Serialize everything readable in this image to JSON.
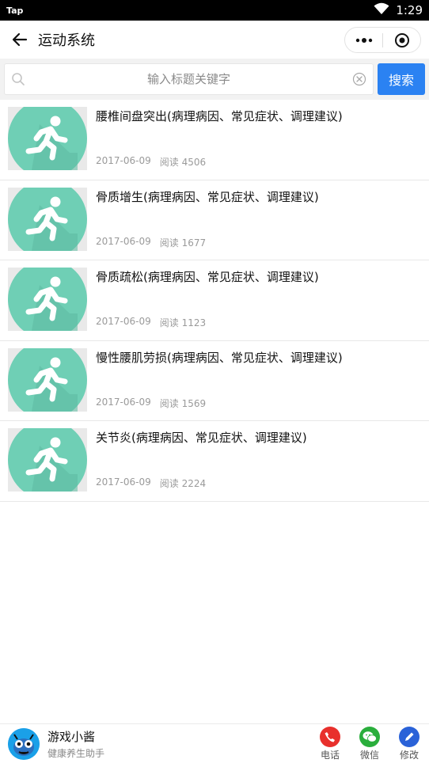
{
  "status_bar": {
    "carrier": "Tap",
    "time": "1:29"
  },
  "nav": {
    "title": "运动系统"
  },
  "search": {
    "placeholder": "输入标题关键字",
    "button_label": "搜索"
  },
  "articles": [
    {
      "title": "腰椎间盘突出(病理病因、常见症状、调理建议)",
      "date": "2017-06-09",
      "reads": "阅读 4506"
    },
    {
      "title": "骨质增生(病理病因、常见症状、调理建议)",
      "date": "2017-06-09",
      "reads": "阅读 1677"
    },
    {
      "title": "骨质疏松(病理病因、常见症状、调理建议)",
      "date": "2017-06-09",
      "reads": "阅读 1123"
    },
    {
      "title": "慢性腰肌劳损(病理病因、常见症状、调理建议)",
      "date": "2017-06-09",
      "reads": "阅读 1569"
    },
    {
      "title": "关节炎(病理病因、常见症状、调理建议)",
      "date": "2017-06-09",
      "reads": "阅读 2224"
    }
  ],
  "footer": {
    "brand_name": "游戏小酱",
    "brand_sub": "健康养生助手",
    "actions": [
      {
        "label": "电话",
        "icon": "phone-icon",
        "color": "#e8302c"
      },
      {
        "label": "微信",
        "icon": "wechat-icon",
        "color": "#2aae3c"
      },
      {
        "label": "修改",
        "icon": "edit-icon",
        "color": "#2a62d8"
      }
    ]
  },
  "colors": {
    "accent": "#2b82f2",
    "thumb_circle": "#6fcfb5"
  }
}
